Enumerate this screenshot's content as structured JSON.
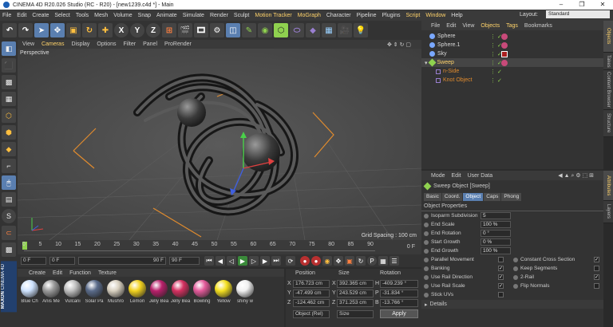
{
  "window": {
    "title": "CINEMA 4D R20.026 Studio (RC - R20) - [new1239.c4d *] - Main"
  },
  "menu": {
    "items": [
      "File",
      "Edit",
      "Create",
      "Select",
      "Tools",
      "Mesh",
      "Volume",
      "Snap",
      "Animate",
      "Simulate",
      "Render",
      "Sculpt",
      "Motion Tracker",
      "MoGraph",
      "Character",
      "Pipeline",
      "Plugins",
      "Script",
      "Window",
      "Help"
    ],
    "layout_label": "Layout:",
    "layout_value": "Standard"
  },
  "toolbar": {
    "axis_labels": [
      "X",
      "Y",
      "Z"
    ]
  },
  "viewport": {
    "menu": [
      "View",
      "Cameras",
      "Display",
      "Options",
      "Filter",
      "Panel",
      "ProRender"
    ],
    "label": "Perspective",
    "grid_spacing": "Grid Spacing : 100 cm"
  },
  "timeline": {
    "ticks": [
      "0",
      "5",
      "10",
      "15",
      "20",
      "25",
      "30",
      "35",
      "40",
      "45",
      "50",
      "55",
      "60",
      "65",
      "70",
      "75",
      "80",
      "85",
      "90"
    ],
    "end_label": "0 F"
  },
  "playback": {
    "current": "0 F",
    "start": "0 F",
    "min_field": "90 F",
    "max_field": "90 F"
  },
  "materials": {
    "menu": [
      "Create",
      "Edit",
      "Function",
      "Texture"
    ],
    "items": [
      {
        "name": "Blue Ch",
        "color": "#cfe3ff"
      },
      {
        "name": "Anis Me",
        "color": "#9a9a9a"
      },
      {
        "name": "Vulcani",
        "color": "#c0c0c0"
      },
      {
        "name": "Solar Pa",
        "color": "#5a6b8a"
      },
      {
        "name": "Mushro",
        "color": "#d8d0c0"
      },
      {
        "name": "Lemon",
        "color": "#f2d21e"
      },
      {
        "name": "Jelly Bea",
        "color": "#b8206a"
      },
      {
        "name": "Jelly Bea",
        "color": "#d43060"
      },
      {
        "name": "Bowling",
        "color": "#e35a9a"
      },
      {
        "name": "Yellow",
        "color": "#f4e020"
      },
      {
        "name": "shiny w",
        "color": "#f0f0f0"
      }
    ]
  },
  "coords": {
    "headers": [
      "Position",
      "Size",
      "Rotation"
    ],
    "rows": [
      {
        "axis": "X",
        "pos": "176.723 cm",
        "size_axis": "X",
        "size": "392.365 cm",
        "rot_axis": "H",
        "rot": "-409.239 °"
      },
      {
        "axis": "Y",
        "pos": "-47.499 cm",
        "size_axis": "Y",
        "size": "243.529 cm",
        "rot_axis": "P",
        "rot": "-31.834 °"
      },
      {
        "axis": "Z",
        "pos": "-124.462 cm",
        "size_axis": "Z",
        "size": "371.253 cm",
        "rot_axis": "B",
        "rot": "-13.766 °"
      }
    ],
    "mode_select": "Object (Rel)",
    "size_select": "Size",
    "apply_label": "Apply"
  },
  "objects": {
    "tabs": [
      "File",
      "Edit",
      "View",
      "Objects",
      "Tags",
      "Bookmarks"
    ],
    "items": [
      {
        "name": "Sphere",
        "indent": 0,
        "color": "#d8d8d8"
      },
      {
        "name": "Sphere.1",
        "indent": 0,
        "color": "#d8d8d8"
      },
      {
        "name": "Sky",
        "indent": 0,
        "color": "#d8d8d8"
      },
      {
        "name": "Sweep",
        "indent": 0,
        "color": "#ffd36b"
      },
      {
        "name": "n-Side",
        "indent": 1,
        "color": "#e08b2e"
      },
      {
        "name": "Knot Object",
        "indent": 1,
        "color": "#e08b2e"
      }
    ]
  },
  "attributes": {
    "menu": [
      "Mode",
      "Edit",
      "User Data"
    ],
    "object_title": "Sweep Object [Sweep]",
    "tabs": [
      "Basic",
      "Coord.",
      "Object",
      "Caps",
      "Phong"
    ],
    "section": "Object Properties",
    "props": [
      {
        "label": "Isoparm Subdivision",
        "value": "5"
      },
      {
        "label": "End Scale",
        "value": "100 %"
      },
      {
        "label": "End Rotation",
        "value": "0 °"
      },
      {
        "label": "Start Growth",
        "value": "0 %"
      },
      {
        "label": "End Growth",
        "value": "100 %"
      }
    ],
    "checks_left": [
      {
        "label": "Parallel Movement",
        "checked": false
      },
      {
        "label": "Banking",
        "checked": true
      },
      {
        "label": "Use Rail Direction",
        "checked": true
      },
      {
        "label": "Use Rail Scale",
        "checked": true
      },
      {
        "label": "Stick UVs",
        "checked": false
      }
    ],
    "checks_right": [
      {
        "label": "Constant Cross Section",
        "checked": true
      },
      {
        "label": "Keep Segments",
        "checked": false
      },
      {
        "label": "2-Rail",
        "checked": true
      },
      {
        "label": "Flip Normals",
        "checked": false
      }
    ],
    "details": "Details"
  },
  "side_tabs": [
    "Objects",
    "Takes",
    "Content Browser",
    "Structure",
    "Attributes",
    "Layers"
  ],
  "brand": {
    "line1": "MAXON",
    "line2": "CINEMA 4D"
  }
}
